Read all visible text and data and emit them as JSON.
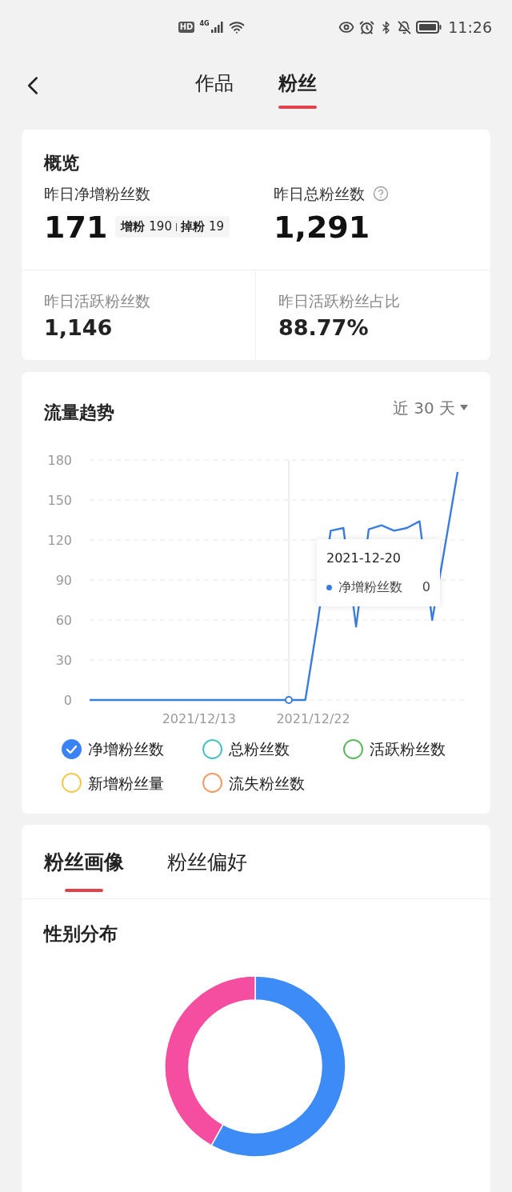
{
  "status_bar": {
    "network_badge": "HD",
    "network_type": "4G",
    "time": "11:26"
  },
  "header": {
    "tabs": [
      {
        "label": "作品",
        "selected": false
      },
      {
        "label": "粉丝",
        "selected": true
      }
    ]
  },
  "overview": {
    "title": "概览",
    "top_metrics": [
      {
        "label": "昨日净增粉丝数",
        "value": "171",
        "help": false,
        "detail": {
          "gain_label": "增粉",
          "gain": "190",
          "loss_label": "掉粉",
          "loss": "19"
        }
      },
      {
        "label": "昨日总粉丝数",
        "value": "1,291",
        "help": true
      }
    ],
    "bottom_metrics": [
      {
        "label": "昨日活跃粉丝数",
        "value": "1,146"
      },
      {
        "label": "昨日活跃粉丝占比",
        "value": "88.77%"
      }
    ]
  },
  "trend": {
    "title": "流量趋势",
    "range": "近 30 天",
    "chart_data": {
      "type": "line",
      "categories": [
        null,
        null,
        null,
        null,
        null,
        null,
        null,
        null,
        null,
        "2021/12/13",
        null,
        null,
        null,
        null,
        null,
        null,
        null,
        null,
        "2021/12/22",
        null,
        null,
        null,
        null,
        null,
        null,
        null,
        null,
        null,
        null,
        null
      ],
      "series": [
        {
          "name": "净增粉丝数",
          "color": "#3b7ddd",
          "values": [
            0,
            0,
            0,
            0,
            0,
            0,
            0,
            0,
            0,
            0,
            0,
            0,
            0,
            0,
            0,
            0,
            0,
            0,
            60,
            127,
            129,
            55,
            128,
            131,
            127,
            129,
            134,
            60,
            115,
            171
          ]
        }
      ],
      "ylim": [
        0,
        180
      ],
      "yticks": [
        0,
        30,
        60,
        90,
        120,
        150,
        180
      ],
      "grid": true
    },
    "tooltip": {
      "date": "2021-12-20",
      "value": "0"
    },
    "legend": [
      {
        "label": "净增粉丝数",
        "color": "#3b82f6",
        "checked": true
      },
      {
        "label": "总粉丝数",
        "color": "#45c2c0",
        "checked": false
      },
      {
        "label": "活跃粉丝数",
        "color": "#5cb85c",
        "checked": false
      },
      {
        "label": "新增粉丝量",
        "color": "#f2c94c",
        "checked": false
      },
      {
        "label": "流失粉丝数",
        "color": "#f09a62",
        "checked": false
      }
    ]
  },
  "portrait": {
    "tabs": [
      {
        "label": "粉丝画像",
        "selected": true
      },
      {
        "label": "粉丝偏好",
        "selected": false
      }
    ],
    "section_title": "性别分布"
  }
}
